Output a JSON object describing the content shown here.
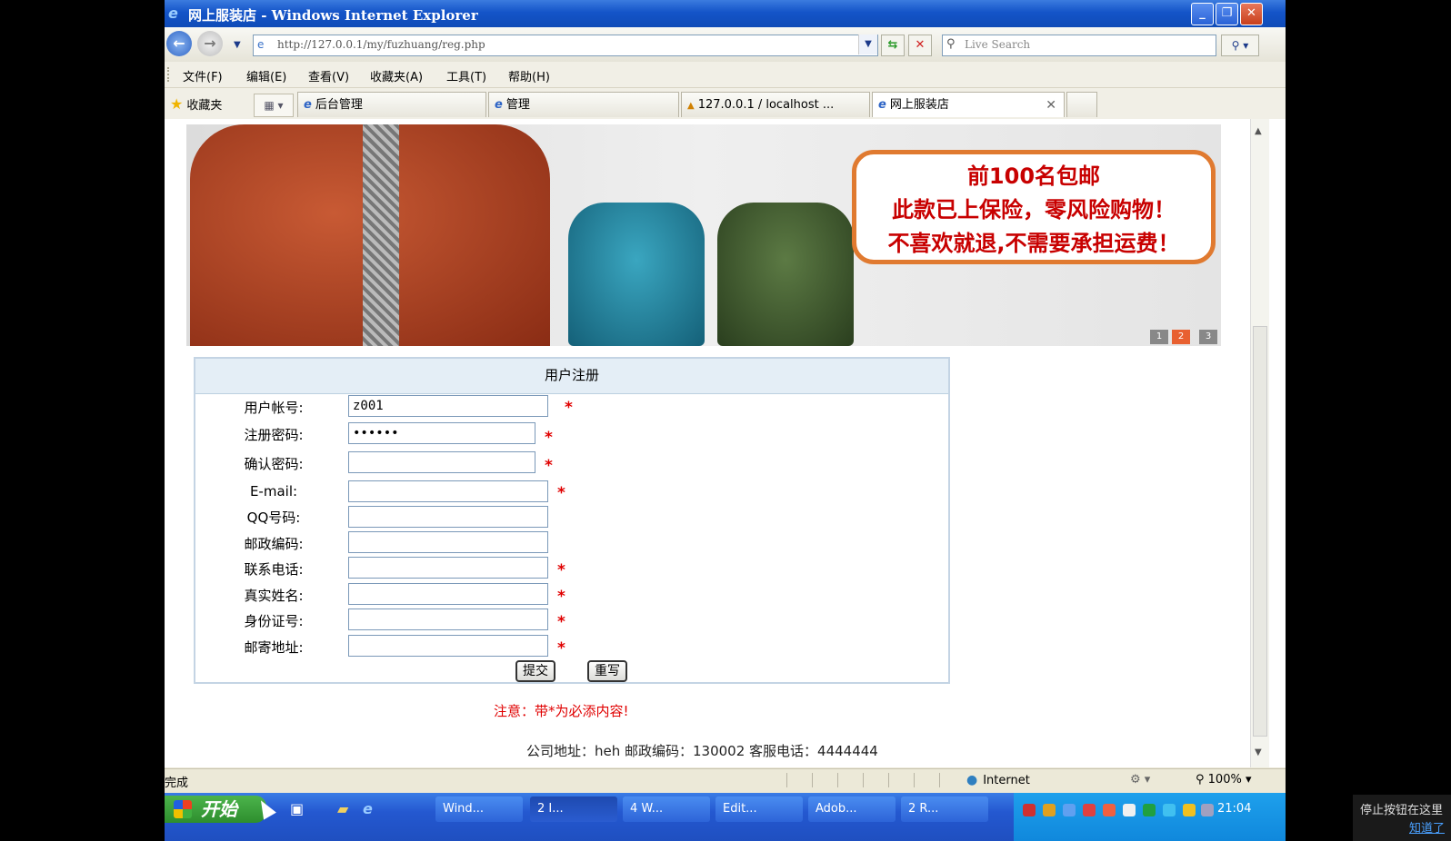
{
  "window": {
    "title": "网上服装店 - Windows Internet Explorer",
    "min": "_",
    "max": "❐",
    "close": "✕"
  },
  "address": {
    "url": "http://127.0.0.1/my/fuzhuang/reg.php",
    "search_placeholder": "Live Search"
  },
  "menu": [
    "文件(F)",
    "编辑(E)",
    "查看(V)",
    "收藏夹(A)",
    "工具(T)",
    "帮助(H)"
  ],
  "favorites_label": "收藏夹",
  "tabs": [
    {
      "label": "后台管理"
    },
    {
      "label": "管理"
    },
    {
      "label": "127.0.0.1 / localhost ..."
    },
    {
      "label": "网上服装店"
    }
  ],
  "banner": {
    "promo_line1": "前100名包邮",
    "promo_line2": "此款已上保险，零风险购物！",
    "promo_line3": "不喜欢就退,不需要承担运费！",
    "slides": [
      "1",
      "2",
      "3"
    ]
  },
  "form": {
    "title": "用户注册",
    "fields": [
      {
        "label": "用户帐号:",
        "value": "z001",
        "required": true
      },
      {
        "label": "注册密码:",
        "value": "••••••",
        "required": true
      },
      {
        "label": "确认密码:",
        "value": "",
        "required": true
      },
      {
        "label": "E-mail:",
        "value": "",
        "required": true
      },
      {
        "label": "QQ号码:",
        "value": "",
        "required": false
      },
      {
        "label": "邮政编码:",
        "value": "",
        "required": false
      },
      {
        "label": "联系电话:",
        "value": "",
        "required": true
      },
      {
        "label": "真实姓名:",
        "value": "",
        "required": true
      },
      {
        "label": "身份证号:",
        "value": "",
        "required": true
      },
      {
        "label": "邮寄地址:",
        "value": "",
        "required": true
      }
    ],
    "required_mark": "*",
    "submit_label": "提交",
    "reset_label": "重写"
  },
  "notice": "注意：带*为必添内容!",
  "footer": "公司地址：heh  邮政编码：130002 客服电话：4444444",
  "status": {
    "text": "完成",
    "zone": "Internet",
    "zoom": "100%"
  },
  "taskbar": {
    "start": "开始",
    "tasks": [
      "Wind...",
      "2 I...",
      "4 W...",
      "Edit...",
      "Adob...",
      "2 R..."
    ],
    "clock": "21:04"
  },
  "notification": {
    "line1": "停止按钮在这里",
    "link": "知道了"
  }
}
